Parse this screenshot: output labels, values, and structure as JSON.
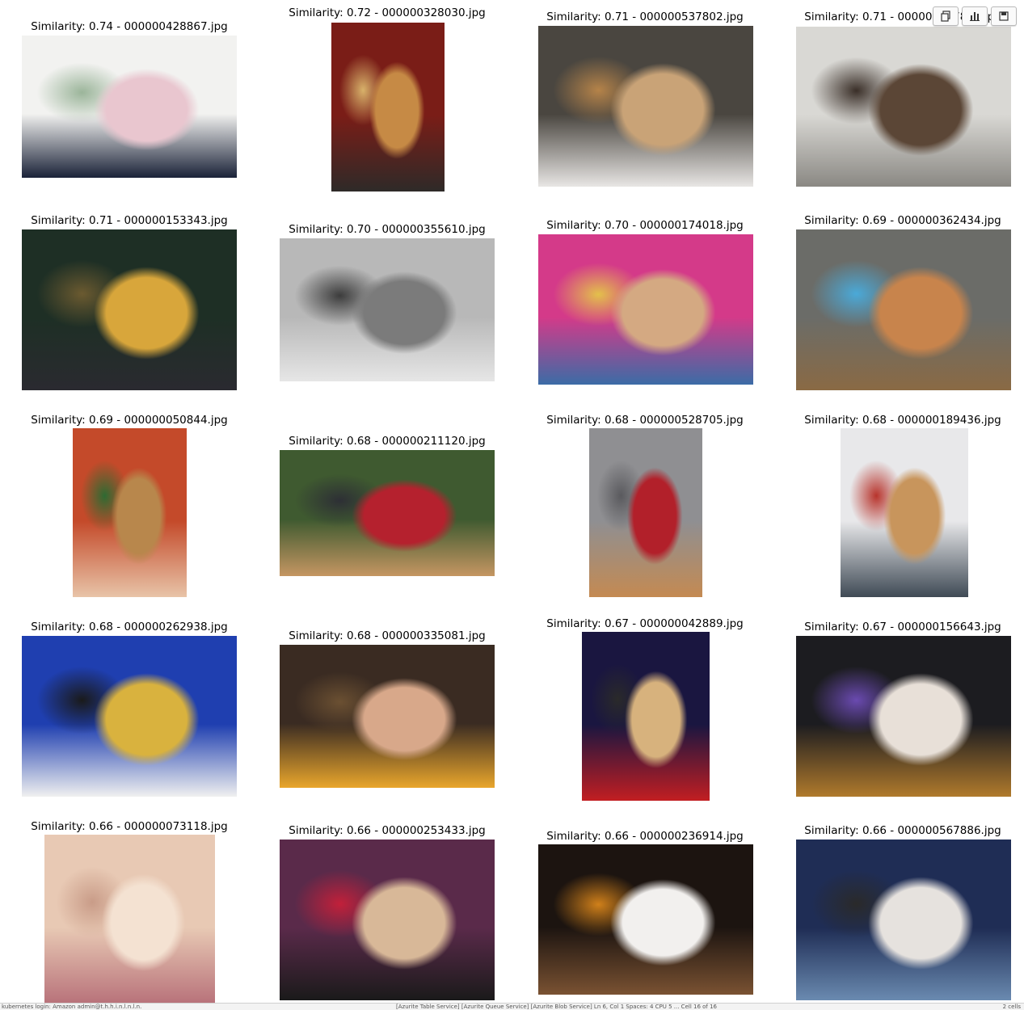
{
  "results": [
    {
      "label": "Similarity: 0.74 - 000000428867.jpg",
      "palette": [
        "#f2f2f0",
        "#e9c6cf",
        "#1a2238",
        "#9bb59a"
      ]
    },
    {
      "label": "Similarity: 0.72 - 000000328030.jpg",
      "palette": [
        "#7a1d17",
        "#c68a45",
        "#2e2a28",
        "#d8b26a"
      ]
    },
    {
      "label": "Similarity: 0.71 - 000000537802.jpg",
      "palette": [
        "#4a4640",
        "#c9a377",
        "#e8e6e4",
        "#b58349"
      ]
    },
    {
      "label": "Similarity: 0.71 - 000000567865.jpg",
      "palette": [
        "#d9d8d4",
        "#5b4636",
        "#8a8883",
        "#3a2f28"
      ]
    },
    {
      "label": "Similarity: 0.71 - 000000153343.jpg",
      "palette": [
        "#1e2f25",
        "#d8a63b",
        "#2a2a30",
        "#6b5a30"
      ]
    },
    {
      "label": "Similarity: 0.70 - 000000355610.jpg",
      "palette": [
        "#b8b8b8",
        "#7b7b7b",
        "#e6e6e6",
        "#3c3c3c"
      ]
    },
    {
      "label": "Similarity: 0.70 - 000000174018.jpg",
      "palette": [
        "#d43a89",
        "#d4a982",
        "#3b6ca6",
        "#e3c04b"
      ]
    },
    {
      "label": "Similarity: 0.69 - 000000362434.jpg",
      "palette": [
        "#6b6c68",
        "#c8844c",
        "#8a6a44",
        "#4aa9d8"
      ]
    },
    {
      "label": "Similarity: 0.69 - 000000050844.jpg",
      "palette": [
        "#c44a2a",
        "#b8874c",
        "#e8c4a8",
        "#2e6a32"
      ]
    },
    {
      "label": "Similarity: 0.68 - 000000211120.jpg",
      "palette": [
        "#3f5a30",
        "#b5212e",
        "#c59662",
        "#2d2f35"
      ]
    },
    {
      "label": "Similarity: 0.68 - 000000528705.jpg",
      "palette": [
        "#8f8f92",
        "#b2202a",
        "#c48a52",
        "#5a5a5e"
      ]
    },
    {
      "label": "Similarity: 0.68 - 000000189436.jpg",
      "palette": [
        "#e8e8ea",
        "#c8955c",
        "#3f4a55",
        "#b8342c"
      ]
    },
    {
      "label": "Similarity: 0.68 - 000000262938.jpg",
      "palette": [
        "#1f3fb0",
        "#d9b23e",
        "#f0f0f0",
        "#1a1a1a"
      ]
    },
    {
      "label": "Similarity: 0.68 - 000000335081.jpg",
      "palette": [
        "#3a2b22",
        "#d8a88a",
        "#e9a62c",
        "#6b5032"
      ]
    },
    {
      "label": "Similarity: 0.67 - 000000042889.jpg",
      "palette": [
        "#1a1640",
        "#d7b27d",
        "#c21e22",
        "#2a2a2a"
      ]
    },
    {
      "label": "Similarity: 0.67 - 000000156643.jpg",
      "palette": [
        "#1c1c20",
        "#e8e0d8",
        "#b07a2c",
        "#6a4ab0"
      ]
    },
    {
      "label": "Similarity: 0.66 - 000000073118.jpg",
      "palette": [
        "#e8c9b4",
        "#f4e2d2",
        "#b8727a",
        "#c99c88"
      ]
    },
    {
      "label": "Similarity: 0.66 - 000000253433.jpg",
      "palette": [
        "#5a2a4a",
        "#d8b898",
        "#1a1a1a",
        "#c2203a"
      ]
    },
    {
      "label": "Similarity: 0.66 - 000000236914.jpg",
      "palette": [
        "#1c1410",
        "#f2f0ee",
        "#7a5232",
        "#d0801a"
      ]
    },
    {
      "label": "Similarity: 0.66 - 000000567886.jpg",
      "palette": [
        "#1f2d55",
        "#e6e2de",
        "#6a8ab0",
        "#2a2a2a"
      ]
    }
  ],
  "toolbar": {
    "buttons": [
      {
        "name": "copy-output-button",
        "icon": "copy-icon"
      },
      {
        "name": "chart-view-button",
        "icon": "bar-chart-icon"
      },
      {
        "name": "save-output-button",
        "icon": "save-icon"
      }
    ]
  },
  "statusbar": {
    "left": "kubernetes login: Amazon admin@t.h.h.i.n.l.n.l.n.",
    "mid": "[Azurite Table Service]   [Azurite Queue Service]   [Azurite Blob Service]   Ln 6, Col 1   Spaces: 4   CPU 5 ... Cell 16 of 16",
    "right": "2 cells"
  }
}
